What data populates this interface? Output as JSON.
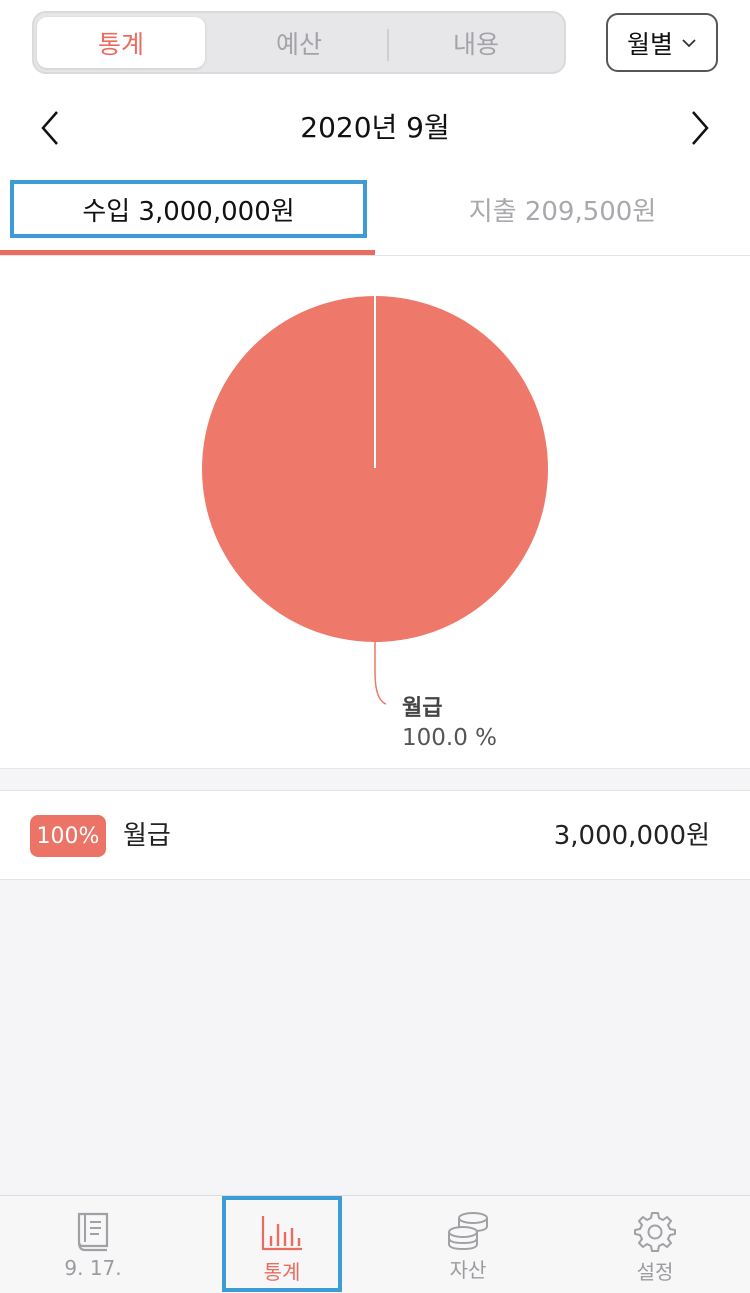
{
  "header": {
    "segments": [
      {
        "label": "통계",
        "active": true
      },
      {
        "label": "예산",
        "active": false
      },
      {
        "label": "내용",
        "active": false
      }
    ],
    "period_label": "월별",
    "period_icon": "chevron-down-icon"
  },
  "month_nav": {
    "title": "2020년 9월",
    "prev_icon": "chevron-left-icon",
    "next_icon": "chevron-right-icon"
  },
  "tabs": {
    "income_label": "수입 3,000,000원",
    "expense_label": "지출 209,500원",
    "active": "income"
  },
  "chart_data": {
    "type": "pie",
    "slices": [
      {
        "label": "월급",
        "percent": 100.0,
        "color": "#ee7869"
      }
    ],
    "label_name": "월급",
    "label_percent": "100.0 %"
  },
  "list": [
    {
      "badge": "100%",
      "name": "월급",
      "amount": "3,000,000원"
    }
  ],
  "tabbar": [
    {
      "label": "9. 17.",
      "icon": "book-icon",
      "active": false
    },
    {
      "label": "통계",
      "icon": "bar-chart-icon",
      "active": true
    },
    {
      "label": "자산",
      "icon": "coins-icon",
      "active": false
    },
    {
      "label": "설정",
      "icon": "gear-icon",
      "active": false
    }
  ],
  "colors": {
    "accent": "#ea6c5e",
    "highlight_border": "#3d9cd6"
  }
}
